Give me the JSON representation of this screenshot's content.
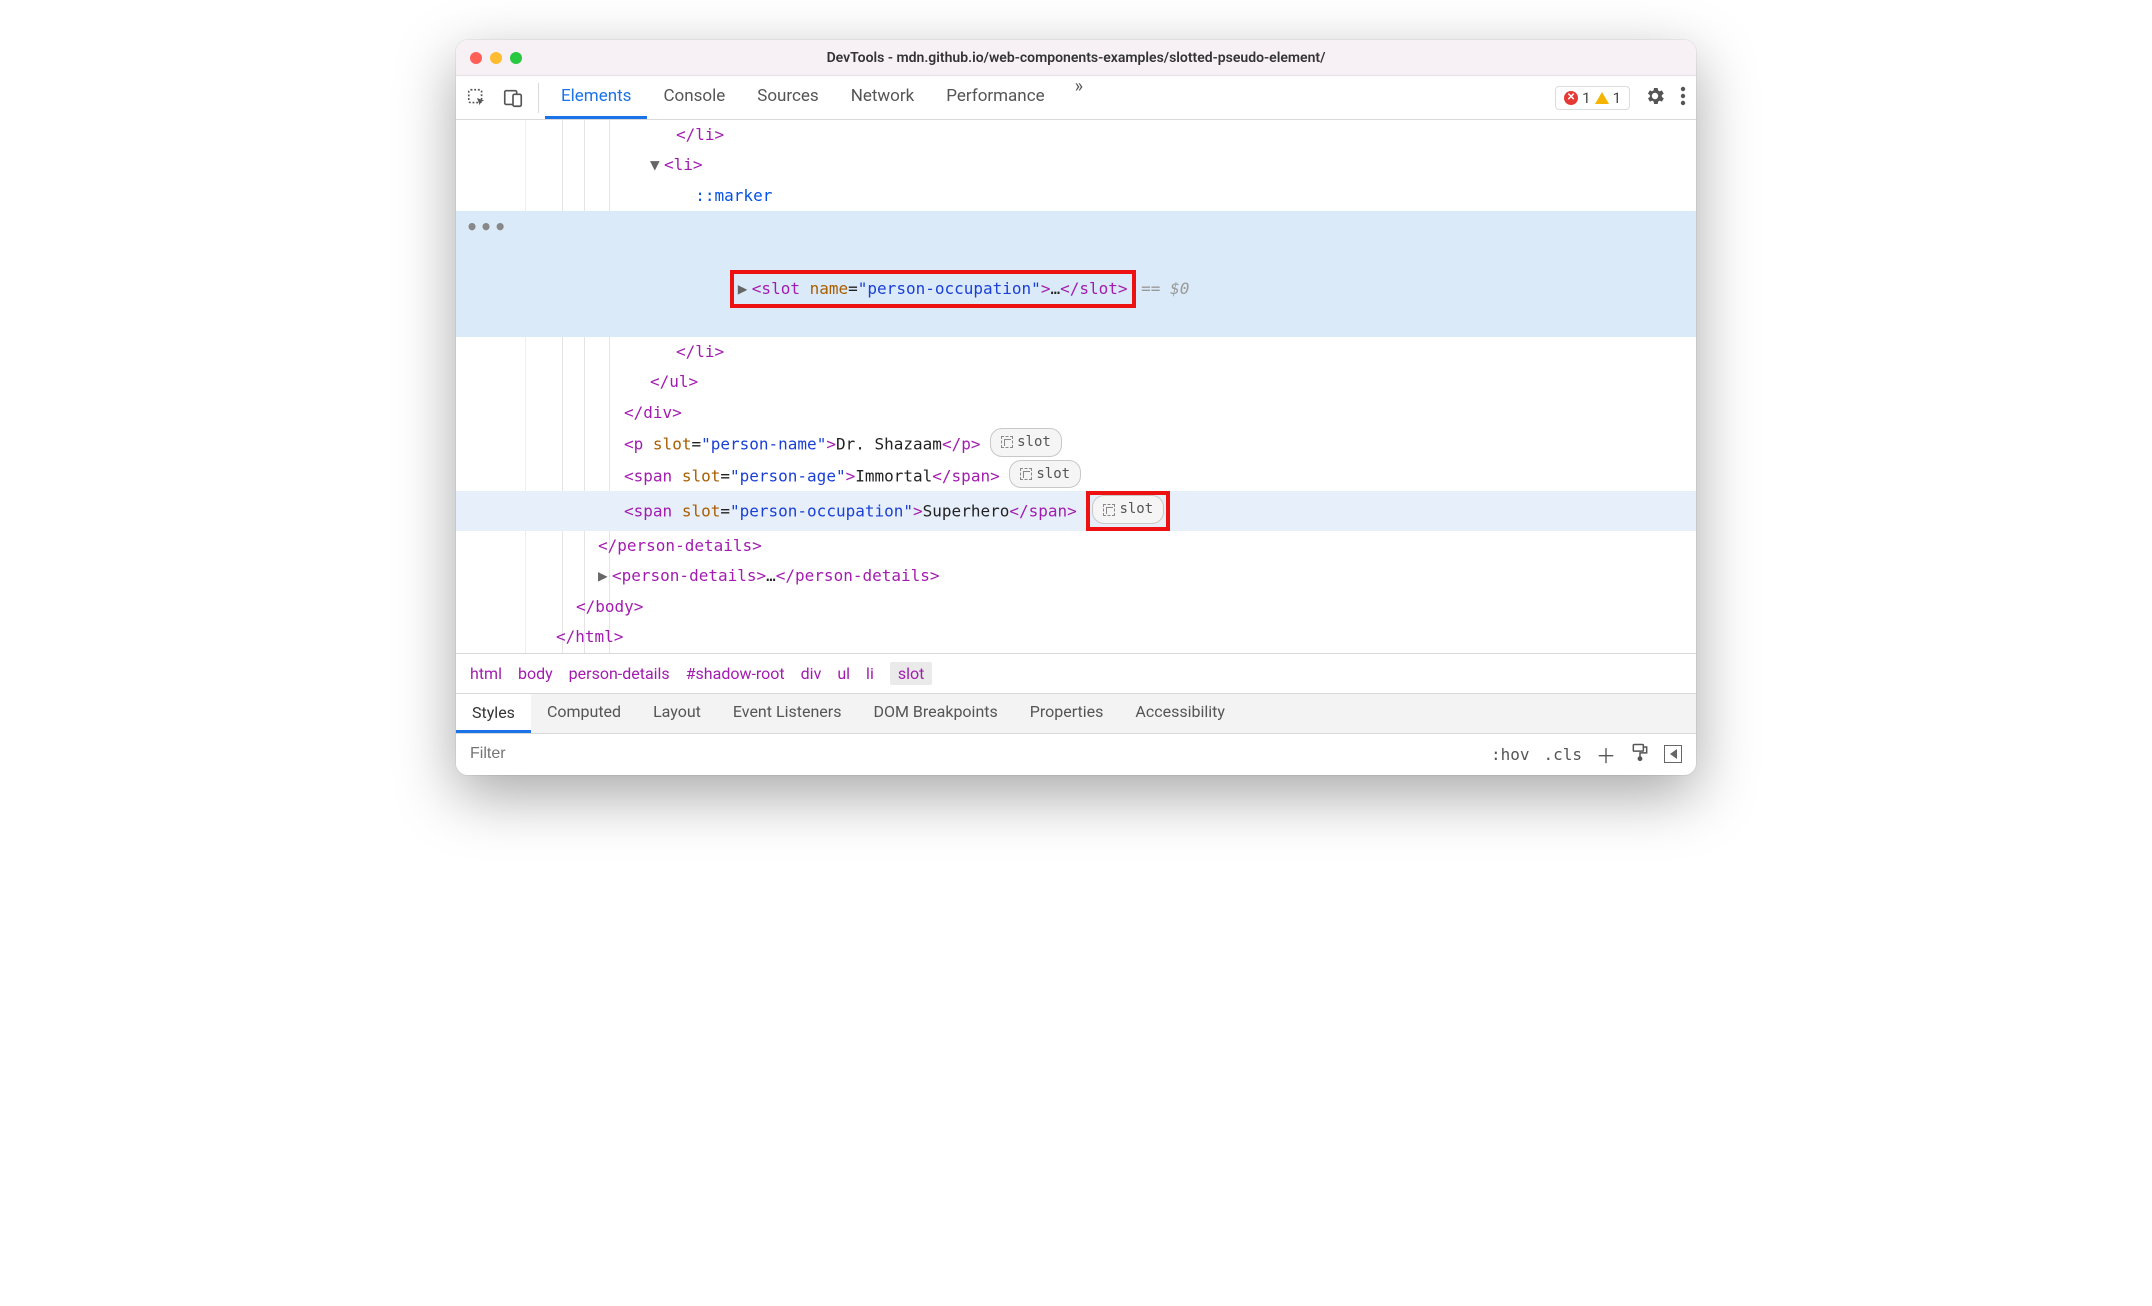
{
  "window": {
    "title": "DevTools - mdn.github.io/web-components-examples/slotted-pseudo-element/"
  },
  "tabs": {
    "items": [
      "Elements",
      "Console",
      "Sources",
      "Network",
      "Performance"
    ],
    "active": 0
  },
  "status": {
    "errors": "1",
    "warnings": "1"
  },
  "dom": {
    "line1_close_li": "</li>",
    "line2_open_li": "<li>",
    "line3_marker": "::marker",
    "line4": {
      "open": "<slot",
      "attr": "name",
      "val": "\"person-occupation\"",
      "gt": ">",
      "ell": "…",
      "close": "</slot>",
      "suffix": " == $0"
    },
    "line5_close_li": "</li>",
    "line6_close_ul": "</ul>",
    "line7_close_div": "</div>",
    "line8": {
      "tag": "p",
      "slot": "\"person-name\"",
      "text": "Dr. Shazaam"
    },
    "line9": {
      "tag": "span",
      "slot": "\"person-age\"",
      "text": "Immortal"
    },
    "line10": {
      "tag": "span",
      "slot": "\"person-occupation\"",
      "text": "Superhero"
    },
    "line11_close_pd": "</person-details>",
    "line12": {
      "open": "<person-details>",
      "ell": "…",
      "close": "</person-details>"
    },
    "line13_close_body": "</body>",
    "line14_close_html": "</html>",
    "slot_badge": "slot"
  },
  "breadcrumb": [
    "html",
    "body",
    "person-details",
    "#shadow-root",
    "div",
    "ul",
    "li",
    "slot"
  ],
  "subtabs": [
    "Styles",
    "Computed",
    "Layout",
    "Event Listeners",
    "DOM Breakpoints",
    "Properties",
    "Accessibility"
  ],
  "filter": {
    "placeholder": "Filter",
    "hov": ":hov",
    "cls": ".cls"
  }
}
